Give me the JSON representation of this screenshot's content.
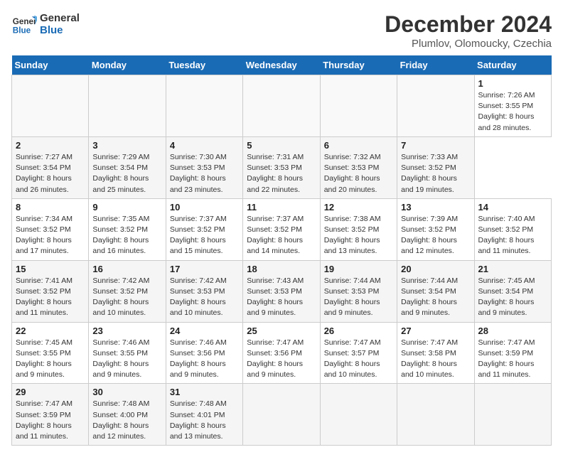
{
  "header": {
    "logo_line1": "General",
    "logo_line2": "Blue",
    "title": "December 2024",
    "subtitle": "Plumlov, Olomoucky, Czechia"
  },
  "calendar": {
    "days_of_week": [
      "Sunday",
      "Monday",
      "Tuesday",
      "Wednesday",
      "Thursday",
      "Friday",
      "Saturday"
    ],
    "weeks": [
      [
        null,
        null,
        null,
        null,
        null,
        null,
        {
          "num": "1",
          "sunrise": "Sunrise: 7:26 AM",
          "sunset": "Sunset: 3:55 PM",
          "daylight": "Daylight: 8 hours and 28 minutes."
        }
      ],
      [
        {
          "num": "2",
          "sunrise": "Sunrise: 7:27 AM",
          "sunset": "Sunset: 3:54 PM",
          "daylight": "Daylight: 8 hours and 26 minutes."
        },
        {
          "num": "3",
          "sunrise": "Sunrise: 7:29 AM",
          "sunset": "Sunset: 3:54 PM",
          "daylight": "Daylight: 8 hours and 25 minutes."
        },
        {
          "num": "4",
          "sunrise": "Sunrise: 7:30 AM",
          "sunset": "Sunset: 3:53 PM",
          "daylight": "Daylight: 8 hours and 23 minutes."
        },
        {
          "num": "5",
          "sunrise": "Sunrise: 7:31 AM",
          "sunset": "Sunset: 3:53 PM",
          "daylight": "Daylight: 8 hours and 22 minutes."
        },
        {
          "num": "6",
          "sunrise": "Sunrise: 7:32 AM",
          "sunset": "Sunset: 3:53 PM",
          "daylight": "Daylight: 8 hours and 20 minutes."
        },
        {
          "num": "7",
          "sunrise": "Sunrise: 7:33 AM",
          "sunset": "Sunset: 3:52 PM",
          "daylight": "Daylight: 8 hours and 19 minutes."
        }
      ],
      [
        {
          "num": "8",
          "sunrise": "Sunrise: 7:34 AM",
          "sunset": "Sunset: 3:52 PM",
          "daylight": "Daylight: 8 hours and 17 minutes."
        },
        {
          "num": "9",
          "sunrise": "Sunrise: 7:35 AM",
          "sunset": "Sunset: 3:52 PM",
          "daylight": "Daylight: 8 hours and 16 minutes."
        },
        {
          "num": "10",
          "sunrise": "Sunrise: 7:37 AM",
          "sunset": "Sunset: 3:52 PM",
          "daylight": "Daylight: 8 hours and 15 minutes."
        },
        {
          "num": "11",
          "sunrise": "Sunrise: 7:37 AM",
          "sunset": "Sunset: 3:52 PM",
          "daylight": "Daylight: 8 hours and 14 minutes."
        },
        {
          "num": "12",
          "sunrise": "Sunrise: 7:38 AM",
          "sunset": "Sunset: 3:52 PM",
          "daylight": "Daylight: 8 hours and 13 minutes."
        },
        {
          "num": "13",
          "sunrise": "Sunrise: 7:39 AM",
          "sunset": "Sunset: 3:52 PM",
          "daylight": "Daylight: 8 hours and 12 minutes."
        },
        {
          "num": "14",
          "sunrise": "Sunrise: 7:40 AM",
          "sunset": "Sunset: 3:52 PM",
          "daylight": "Daylight: 8 hours and 11 minutes."
        }
      ],
      [
        {
          "num": "15",
          "sunrise": "Sunrise: 7:41 AM",
          "sunset": "Sunset: 3:52 PM",
          "daylight": "Daylight: 8 hours and 11 minutes."
        },
        {
          "num": "16",
          "sunrise": "Sunrise: 7:42 AM",
          "sunset": "Sunset: 3:52 PM",
          "daylight": "Daylight: 8 hours and 10 minutes."
        },
        {
          "num": "17",
          "sunrise": "Sunrise: 7:42 AM",
          "sunset": "Sunset: 3:53 PM",
          "daylight": "Daylight: 8 hours and 10 minutes."
        },
        {
          "num": "18",
          "sunrise": "Sunrise: 7:43 AM",
          "sunset": "Sunset: 3:53 PM",
          "daylight": "Daylight: 8 hours and 9 minutes."
        },
        {
          "num": "19",
          "sunrise": "Sunrise: 7:44 AM",
          "sunset": "Sunset: 3:53 PM",
          "daylight": "Daylight: 8 hours and 9 minutes."
        },
        {
          "num": "20",
          "sunrise": "Sunrise: 7:44 AM",
          "sunset": "Sunset: 3:54 PM",
          "daylight": "Daylight: 8 hours and 9 minutes."
        },
        {
          "num": "21",
          "sunrise": "Sunrise: 7:45 AM",
          "sunset": "Sunset: 3:54 PM",
          "daylight": "Daylight: 8 hours and 9 minutes."
        }
      ],
      [
        {
          "num": "22",
          "sunrise": "Sunrise: 7:45 AM",
          "sunset": "Sunset: 3:55 PM",
          "daylight": "Daylight: 8 hours and 9 minutes."
        },
        {
          "num": "23",
          "sunrise": "Sunrise: 7:46 AM",
          "sunset": "Sunset: 3:55 PM",
          "daylight": "Daylight: 8 hours and 9 minutes."
        },
        {
          "num": "24",
          "sunrise": "Sunrise: 7:46 AM",
          "sunset": "Sunset: 3:56 PM",
          "daylight": "Daylight: 8 hours and 9 minutes."
        },
        {
          "num": "25",
          "sunrise": "Sunrise: 7:47 AM",
          "sunset": "Sunset: 3:56 PM",
          "daylight": "Daylight: 8 hours and 9 minutes."
        },
        {
          "num": "26",
          "sunrise": "Sunrise: 7:47 AM",
          "sunset": "Sunset: 3:57 PM",
          "daylight": "Daylight: 8 hours and 10 minutes."
        },
        {
          "num": "27",
          "sunrise": "Sunrise: 7:47 AM",
          "sunset": "Sunset: 3:58 PM",
          "daylight": "Daylight: 8 hours and 10 minutes."
        },
        {
          "num": "28",
          "sunrise": "Sunrise: 7:47 AM",
          "sunset": "Sunset: 3:59 PM",
          "daylight": "Daylight: 8 hours and 11 minutes."
        }
      ],
      [
        {
          "num": "29",
          "sunrise": "Sunrise: 7:47 AM",
          "sunset": "Sunset: 3:59 PM",
          "daylight": "Daylight: 8 hours and 11 minutes."
        },
        {
          "num": "30",
          "sunrise": "Sunrise: 7:48 AM",
          "sunset": "Sunset: 4:00 PM",
          "daylight": "Daylight: 8 hours and 12 minutes."
        },
        {
          "num": "31",
          "sunrise": "Sunrise: 7:48 AM",
          "sunset": "Sunset: 4:01 PM",
          "daylight": "Daylight: 8 hours and 13 minutes."
        },
        null,
        null,
        null,
        null
      ]
    ]
  }
}
